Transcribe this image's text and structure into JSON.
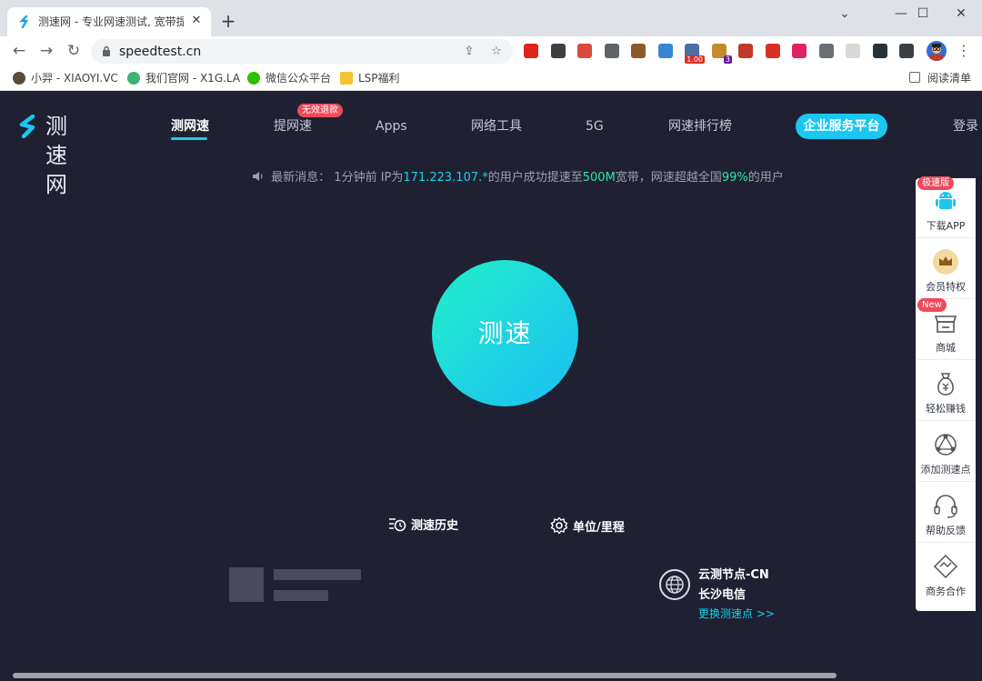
{
  "browser": {
    "tab": {
      "title": "测速网 - 专业网速测试, 宽带提速",
      "close_glyph": "✕"
    },
    "new_tab_glyph": "+",
    "window_controls": {
      "dropdown": "⌄",
      "minimize": "—",
      "maximize": "☐",
      "close": "✕"
    },
    "toolbar": {
      "back": "←",
      "forward": "→",
      "reload": "↻",
      "url": "speedtest.cn",
      "share": "⇪",
      "star": "☆",
      "menu": "⋮"
    },
    "extensions": [
      {
        "name": "ext-red-shield",
        "color": "#e0241b"
      },
      {
        "name": "ext-dark-box",
        "color": "#3c4043"
      },
      {
        "name": "ext-pen",
        "color": "#d94c3d"
      },
      {
        "name": "ext-copy",
        "color": "#5f6368"
      },
      {
        "name": "ext-cookie",
        "color": "#8a5a2b"
      },
      {
        "name": "ext-image",
        "color": "#3a86d6"
      },
      {
        "name": "ext-flag-badge",
        "color": "#4a6fa5",
        "badge": "1.00",
        "badge_color": "#d93025"
      },
      {
        "name": "ext-monkey-badge",
        "color": "#c78a2a",
        "badge": "3",
        "badge_color": "#6a1b9a"
      },
      {
        "name": "ext-colorful",
        "color": "#c0392b"
      },
      {
        "name": "ext-red-alert",
        "color": "#d93025"
      },
      {
        "name": "ext-red-eye",
        "color": "#e0245e"
      },
      {
        "name": "ext-gray-arrow",
        "color": "#6b6f75"
      },
      {
        "name": "ext-book",
        "color": "#d8d8d8"
      },
      {
        "name": "ext-dark-app",
        "color": "#263238"
      },
      {
        "name": "ext-puzzle",
        "color": "#3c4043"
      }
    ],
    "bookmarks": [
      {
        "label": "小羿 - XIAOYI.VC",
        "color": "#5a4a3a"
      },
      {
        "label": "我们官网 - X1G.LA",
        "color": "#3cb371"
      },
      {
        "label": "微信公众平台",
        "color": "#2dc100"
      },
      {
        "label": "LSP福利",
        "color": "#f4c430"
      }
    ],
    "reading_list": "阅读清单"
  },
  "site": {
    "logo_text": "测速网",
    "nav": [
      {
        "label": "测网速",
        "active": true
      },
      {
        "label": "提网速"
      },
      {
        "label": "Apps"
      },
      {
        "label": "网络工具"
      },
      {
        "label": "5G"
      },
      {
        "label": "网速排行榜"
      }
    ],
    "nav_badge": "无效退款",
    "enterprise_button": "企业服务平台",
    "login": "登录",
    "news": {
      "prefix": "最新消息：",
      "time": "1分钟前",
      "ip_label": "IP为",
      "ip": "171.223.107.*",
      "mid": "的用户成功提速至",
      "speed": "500M",
      "tail": "宽带，网速超越全国",
      "percent": "99%",
      "end": "的用户"
    },
    "speed_button": "测速",
    "history_link": "测速历史",
    "units_link": "单位/里程",
    "node": {
      "name": "云测节点-CN",
      "isp": "长沙电信",
      "change": "更换测速点 >>"
    },
    "side_panel": [
      {
        "label": "下载APP",
        "badge": "极速版",
        "icon": "android-icon"
      },
      {
        "label": "会员特权",
        "icon": "crown-icon"
      },
      {
        "label": "商城",
        "badge": "New",
        "icon": "shop-icon"
      },
      {
        "label": "轻松赚钱",
        "icon": "money-bag-icon"
      },
      {
        "label": "添加测速点",
        "icon": "network-node-icon"
      },
      {
        "label": "帮助反馈",
        "icon": "headset-icon"
      },
      {
        "label": "商务合作",
        "icon": "handshake-icon"
      }
    ],
    "colors": {
      "background": "#1f2133",
      "accent": "#19d0e8",
      "highlight": "#2ee6a6"
    }
  }
}
